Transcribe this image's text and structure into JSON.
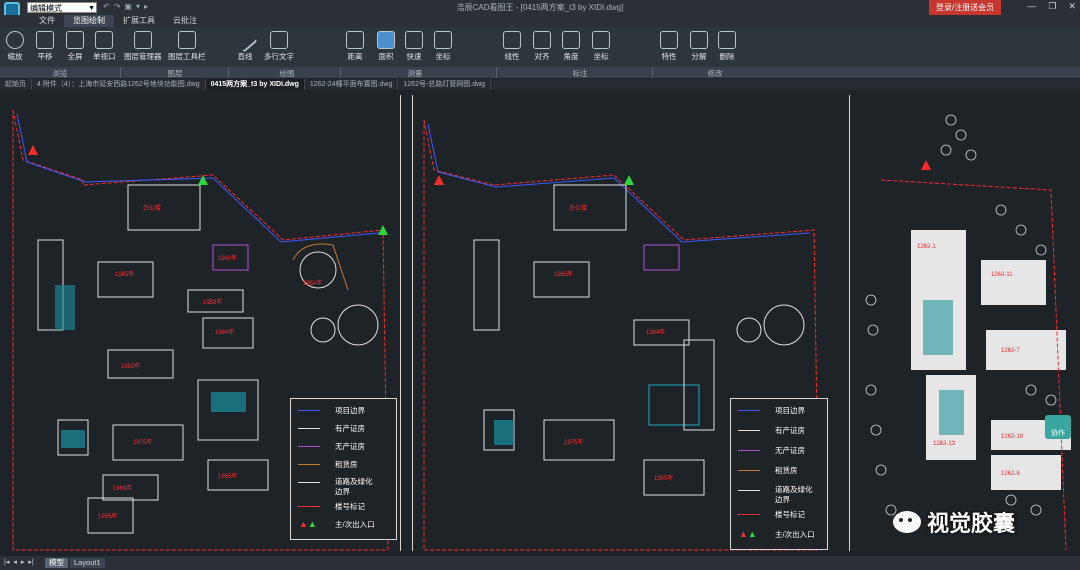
{
  "titlebar": {
    "mode": "编辑模式",
    "title": "浩辰CAD看图王 - [0415两方案_t3 by XIDI.dwg]",
    "login": "登录/注册送会员",
    "qat": [
      "↶",
      "↷",
      "▣",
      "▾",
      "▸"
    ],
    "minimize": "—",
    "restore": "❐",
    "close": "✕"
  },
  "menus": [
    "文件",
    "览图绘制",
    "扩展工具",
    "云批注"
  ],
  "ribbon": {
    "buttons": [
      "缩放",
      "平移",
      "全屏",
      "单视口",
      "图层管理器",
      "图层工具栏",
      "直线",
      "多行文字",
      "距离",
      "面积",
      "快速",
      "坐标",
      "线性",
      "对齐",
      "角度",
      "坐标",
      "特性",
      "分解",
      "删除"
    ],
    "groups": [
      "浏览",
      "图层",
      "绘图",
      "测量",
      "标注",
      "修改"
    ]
  },
  "tabs": [
    "起始页",
    "4 附件（4）：上海市延安西路1262号地块功能图.dwg",
    "0415两方案_t3 by XIDI.dwg",
    "1262-24幢平面布置图.dwg",
    "1262号-总路灯管网图.dwg"
  ],
  "legend": {
    "items": [
      "项目边界",
      "有产证房",
      "无产证房",
      "租赁房",
      "道路及绿化边界",
      "楼号标记",
      "主/次出入口"
    ],
    "colors": [
      "#3b5bff",
      "#e0e0e0",
      "#b44cd8",
      "#c87a2c",
      "#e0e0e0",
      "#ff2b2b",
      "#ff2b2b"
    ]
  },
  "drawing_labels": {
    "a": [
      "1965年",
      "1975年",
      "1984年",
      "1953年",
      "1955年",
      "1960年",
      "1985年",
      "1969年",
      "1995年",
      "1954年"
    ],
    "b": [
      "1965年",
      "1975年",
      "1984年",
      "1955年"
    ],
    "c": [
      "1262-1",
      "1262-11",
      "1262-13",
      "1262-7",
      "1262-10",
      "1262-5"
    ]
  },
  "layouts": [
    "模型",
    "Layout1"
  ],
  "nav": [
    "|◂",
    "◂",
    "▸",
    "▸|"
  ],
  "collab": "协作",
  "watermark": "视觉胶囊"
}
